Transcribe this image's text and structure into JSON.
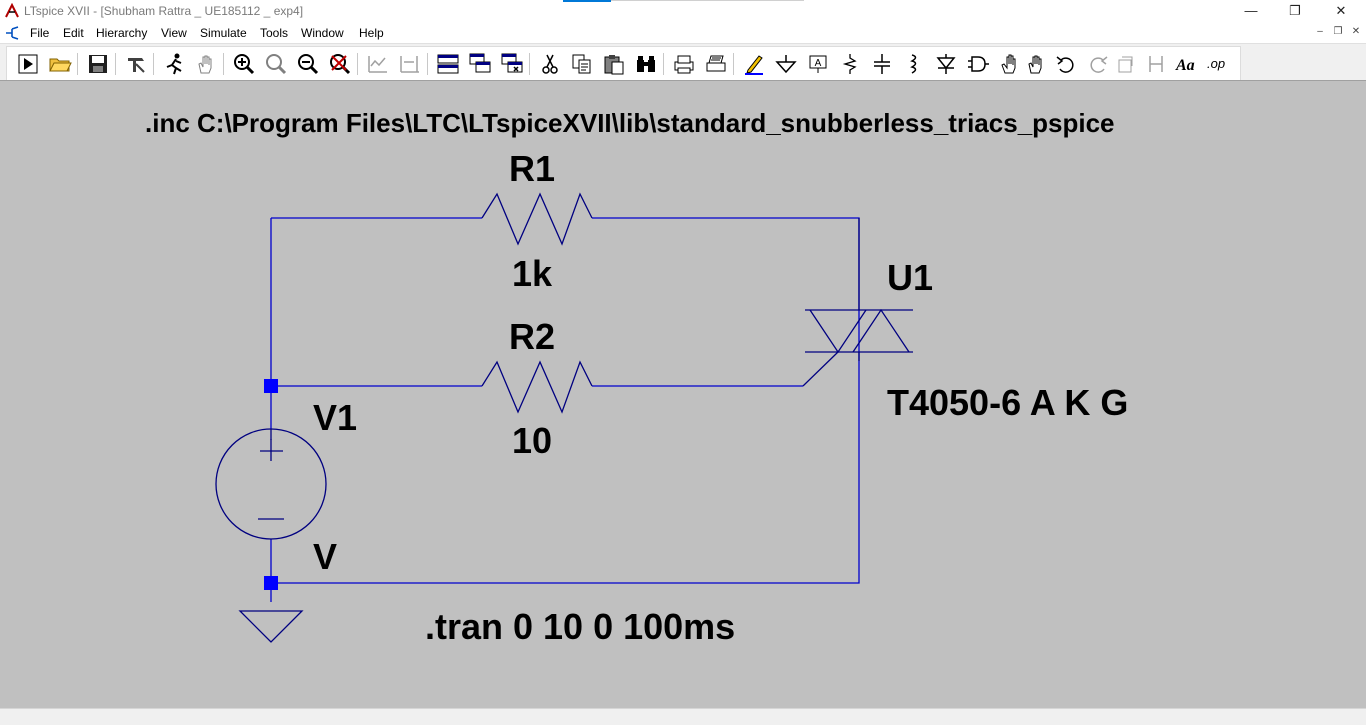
{
  "window": {
    "title": "LTspice XVII - [Shubham Rattra _ UE185112 _ exp4]",
    "controls": {
      "minimize": "—",
      "restore": "❐",
      "close": "✕"
    }
  },
  "menu": {
    "items": [
      "File",
      "Edit",
      "Hierarchy",
      "View",
      "Simulate",
      "Tools",
      "Window",
      "Help"
    ]
  },
  "toolbar": {
    "buttons": [
      "run",
      "open",
      "save",
      "control-panel",
      "halt",
      "pan",
      "zoom-in",
      "zoom-out",
      "zoom-back",
      "zoom-fit",
      "autoscale-y",
      "autoscale-x",
      "tile",
      "cascade",
      "close-window",
      "cut",
      "copy",
      "paste",
      "find",
      "print",
      "print-preview",
      "draw-wire",
      "ground",
      "label-net",
      "resistor",
      "capacitor",
      "inductor",
      "diode",
      "component",
      "move",
      "drag",
      "undo",
      "redo",
      "rotate",
      "mirror",
      "text",
      "spice-directive"
    ]
  },
  "schematic": {
    "include_directive": ".inc C:\\Program Files\\LTC\\LTspiceXVII\\lib\\standard_snubberless_triacs_pspice",
    "r1": {
      "name": "R1",
      "value": "1k"
    },
    "r2": {
      "name": "R2",
      "value": "10"
    },
    "u1": {
      "name": "U1",
      "value": "T4050-6 A K G"
    },
    "v1": {
      "name": "V1",
      "value": "V"
    },
    "tran_directive": ".tran 0 10 0 100ms",
    "colors": {
      "wire": "#0000cc",
      "node": "#0000ff",
      "component": "#000080",
      "background": "#c0c0c0"
    }
  }
}
